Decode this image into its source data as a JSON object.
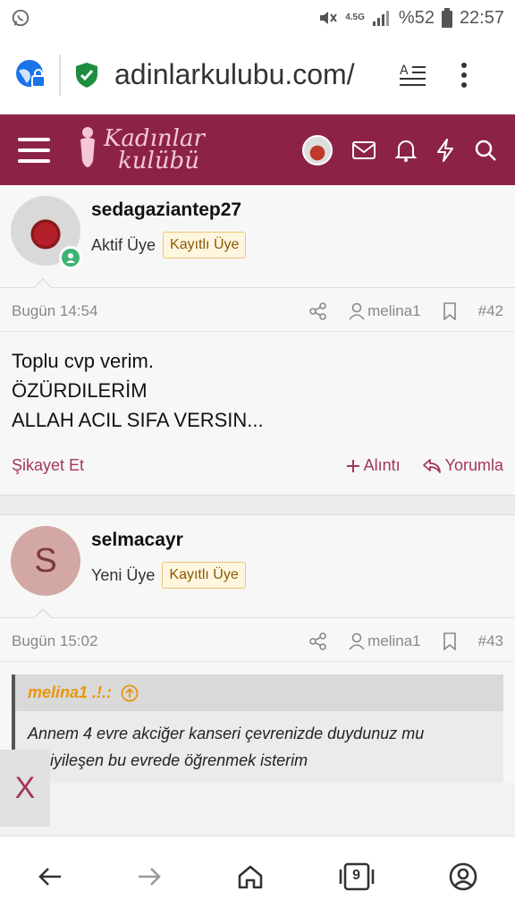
{
  "status_bar": {
    "network_label": "4.5G",
    "battery_percent": "%52",
    "time": "22:57"
  },
  "browser": {
    "url": "adinlarkulubu.com/"
  },
  "site_header": {
    "logo_line1": "Kadınlar",
    "logo_line2": "kulübü",
    "brand_color": "#8c2346"
  },
  "posts": [
    {
      "username": "sedagaziantep27",
      "rank": "Aktif Üye",
      "badge": "Kayıtlı Üye",
      "time": "Bugün 14:54",
      "quoted_user": "melina1",
      "post_number": "#42",
      "body": [
        "Toplu cvp verim.",
        "ÖZÜRDILERİM",
        "ALLAH ACIL SIFA VERSIN..."
      ],
      "actions": {
        "report": "Şikayet Et",
        "quote": "Alıntı",
        "reply": "Yorumla"
      }
    },
    {
      "username": "selmacayr",
      "avatar_letter": "S",
      "rank": "Yeni Üye",
      "badge": "Kayıtlı Üye",
      "time": "Bugün 15:02",
      "quoted_user": "melina1",
      "post_number": "#43",
      "quote": {
        "author": "melina1 .!.:",
        "lines": [
          "Annem 4 evre akciğer kanseri çevrenizde duydunuz mu",
          "bu iyileşen bu evrede öğrenmek isterim"
        ]
      }
    }
  ],
  "close_tab_label": "X",
  "bottom_nav": {
    "tabs_count": "9"
  }
}
